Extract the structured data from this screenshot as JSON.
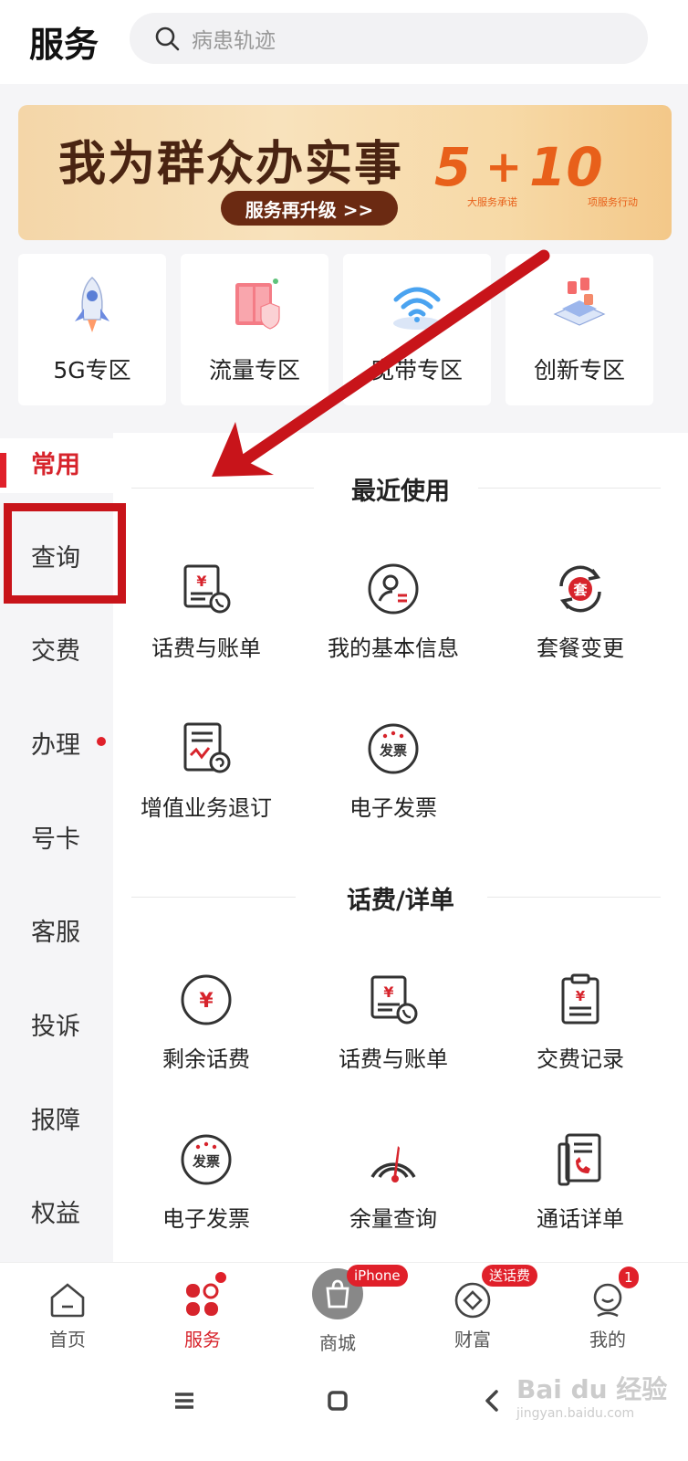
{
  "header": {
    "title": "服务",
    "search_placeholder": "病患轨迹"
  },
  "banner": {
    "headline": "我为群众办实事",
    "pill": "服务再升级 >>",
    "num1": "5",
    "plus": "+",
    "num2": "10",
    "sub1": "大服务承诺",
    "sub2": "项服务行动"
  },
  "zones": [
    {
      "label": "5G专区",
      "icon": "rocket-icon"
    },
    {
      "label": "流量专区",
      "icon": "storage-cabinet-icon"
    },
    {
      "label": "宽带专区",
      "icon": "wifi-icon"
    },
    {
      "label": "创新专区",
      "icon": "innovation-blocks-icon"
    }
  ],
  "side_menu": [
    {
      "label": "常用",
      "active": true
    },
    {
      "label": "查询"
    },
    {
      "label": "交费"
    },
    {
      "label": "办理",
      "dot": true
    },
    {
      "label": "号卡"
    },
    {
      "label": "客服"
    },
    {
      "label": "投诉"
    },
    {
      "label": "报障"
    },
    {
      "label": "权益"
    }
  ],
  "sections": [
    {
      "title": "最近使用",
      "items": [
        {
          "label": "话费与账单",
          "icon": "bill-icon"
        },
        {
          "label": "我的基本信息",
          "icon": "profile-icon"
        },
        {
          "label": "套餐变更",
          "icon": "package-change-icon"
        },
        {
          "label": "增值业务退订",
          "icon": "unsubscribe-icon"
        },
        {
          "label": "电子发票",
          "icon": "invoice-icon"
        }
      ]
    },
    {
      "title": "话费/详单",
      "items": [
        {
          "label": "剩余话费",
          "icon": "yuan-balance-icon"
        },
        {
          "label": "话费与账单",
          "icon": "bill-icon"
        },
        {
          "label": "交费记录",
          "icon": "payment-record-icon"
        },
        {
          "label": "电子发票",
          "icon": "invoice-icon"
        },
        {
          "label": "余量查询",
          "icon": "gauge-icon"
        },
        {
          "label": "通话详单",
          "icon": "call-detail-icon"
        }
      ]
    }
  ],
  "bottom_nav": [
    {
      "label": "首页",
      "icon": "home-icon"
    },
    {
      "label": "服务",
      "icon": "service-icon",
      "active": true
    },
    {
      "label": "商城",
      "icon": "shopping-bag-icon",
      "badge": "iPhone"
    },
    {
      "label": "财富",
      "icon": "wealth-icon",
      "badge": "送话费"
    },
    {
      "label": "我的",
      "icon": "profile-face-icon",
      "badge": "1"
    }
  ],
  "invoice_icon_text": "发票",
  "package_icon_text": "套",
  "yuan_symbol": "¥",
  "watermark": {
    "text": "Bai du 经验",
    "sub": "jingyan.baidu.com"
  },
  "colors": {
    "accent": "#d7242c",
    "annotation": "#c8141a"
  }
}
